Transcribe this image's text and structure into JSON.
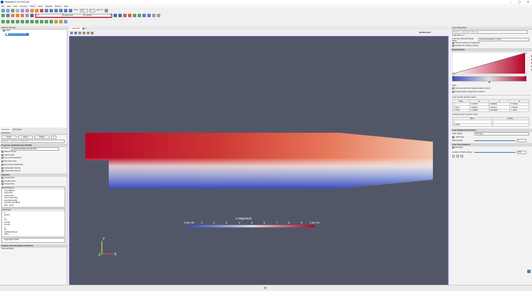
{
  "window": {
    "title": "ParaView 5.12.0-RC3-64",
    "btn_min": "–",
    "btn_max": "▢",
    "btn_close": "✕"
  },
  "menu": [
    "File",
    "Edit",
    "View",
    "Sources",
    "Filters",
    "Tools",
    "Catalyst",
    "Macros",
    "Help"
  ],
  "toolbar": {
    "time_label": "Time:",
    "time_value": "100",
    "frame_value": "0",
    "color_array": "U",
    "color_component": "Magnitude",
    "representation": "Surface",
    "last_frame": "max is 0"
  },
  "pipeline": {
    "title": "Pipeline Browser",
    "root": "builtin:",
    "source": "pitzDaily.OpenFOAM"
  },
  "properties": {
    "tabs": [
      "Properties",
      "Information"
    ],
    "title": "Properties",
    "btn_apply": "Apply",
    "btn_reset": "Reset",
    "btn_delete": "Delete",
    "btn_help": "?",
    "search_placeholder": "Search ... (use Esc to clear text)",
    "section_source": "Properties (pitzDaily.OpenFOAM)",
    "file_name_label": "File Name",
    "file_name_value": "pitzDaily/pitzDaily.OpenFOAM",
    "checks": [
      "Refresh Times",
      "Cache Mesh",
      "Case Type",
      "Use VTK Polyhedron",
      "Skip Zero Time",
      "Decompose Polyhedra",
      "Extrapolate Patches",
      "Read Zones",
      "Show Patch Names"
    ],
    "selection_label": "Selection",
    "include_sets": "Include Sets",
    "include_zones": "Include Zones",
    "groups_label": "Groups Only",
    "mesh_regions_label": "Mesh Regions",
    "mesh_regions": [
      "internalMesh",
      "patch/inlet",
      "patch/outlet",
      "patch/upperWall",
      "patch/lowerWall",
      "patch/frontAndBack",
      "wall - group"
    ],
    "cell_arrays_label": "Cell Arrays",
    "cell_arrays": [
      "U",
      "epsilon",
      "k",
      "nut",
      "nuTilda",
      "omega",
      "p",
      "phi",
      "wallShearStress",
      "yPlus"
    ],
    "lagrangian_label": "Lagrangian Fields",
    "display_section": "Display (GeometryRepresentation)",
    "representation_label": "Representation"
  },
  "view": {
    "tab": "Layout #1",
    "render_view": "RenderView1",
    "legend_title": "U Magnitude",
    "legend_min": "0.0e+00",
    "legend_max": "1.0e+01",
    "legend_ticks": [
      "1",
      "2",
      "3",
      "4",
      "5",
      "6",
      "7",
      "8",
      "9"
    ],
    "axis_y": "Y",
    "axis_z": "Z",
    "axis_x": "X"
  },
  "colormap": {
    "title": "Color Map Editor",
    "search_placeholder": "Search ... (use Esc to clear text)",
    "array_name": "Array Name: U",
    "auto_range_label": "Automatic Rescale Range Mode",
    "auto_range_value": "Grow and update on 'Apply'",
    "interpret_categories": "Interpret Values As Categories",
    "rescale_visible": "Rescale On Visibility Change",
    "mapping_data": "Mapping Data",
    "data_label": "Data:",
    "use_log_scale": "Use log scale when mapping data to colors",
    "enable_opacity": "Enable opacity mapping for surfaces",
    "color_tf_values": "Color transfer function values",
    "color_tf_headers": [
      "Value",
      "R",
      "G",
      "B"
    ],
    "color_tf_rows": [
      [
        "0",
        "0.231373",
        "0.298039",
        "0.752941"
      ],
      [
        "4.99372",
        "0.865003",
        "0.865003",
        "0.865003"
      ],
      [
        "10.1849",
        "0.705882",
        "0.0156863",
        "0.14902"
      ]
    ],
    "opacity_tf_values": "Opacity transfer function values",
    "opacity_headers": [
      "Value",
      "Opacity"
    ],
    "opacity_rows": [
      [
        "0",
        "0"
      ],
      [
        "10.1849",
        "1"
      ]
    ],
    "color_mapping_params": "Color Mapping Parameters",
    "color_space_label": "Color Space",
    "color_space_value": "Diverging",
    "nan_color": "NaN Color",
    "nan_opacity": "NaN Opacity",
    "nan_opacity_value": "1",
    "color_discretization": "Color Discretization",
    "discretize": "Discretize",
    "num_table_values_label": "Number Of Table Values",
    "num_table_values": "256"
  },
  "colors": {
    "viewport_bg": "#525768",
    "cold": "#3b4cc0",
    "warm": "#b40426",
    "mid": "#dddddd",
    "accent": "#9e8cff",
    "highlight": "#d8001a"
  }
}
